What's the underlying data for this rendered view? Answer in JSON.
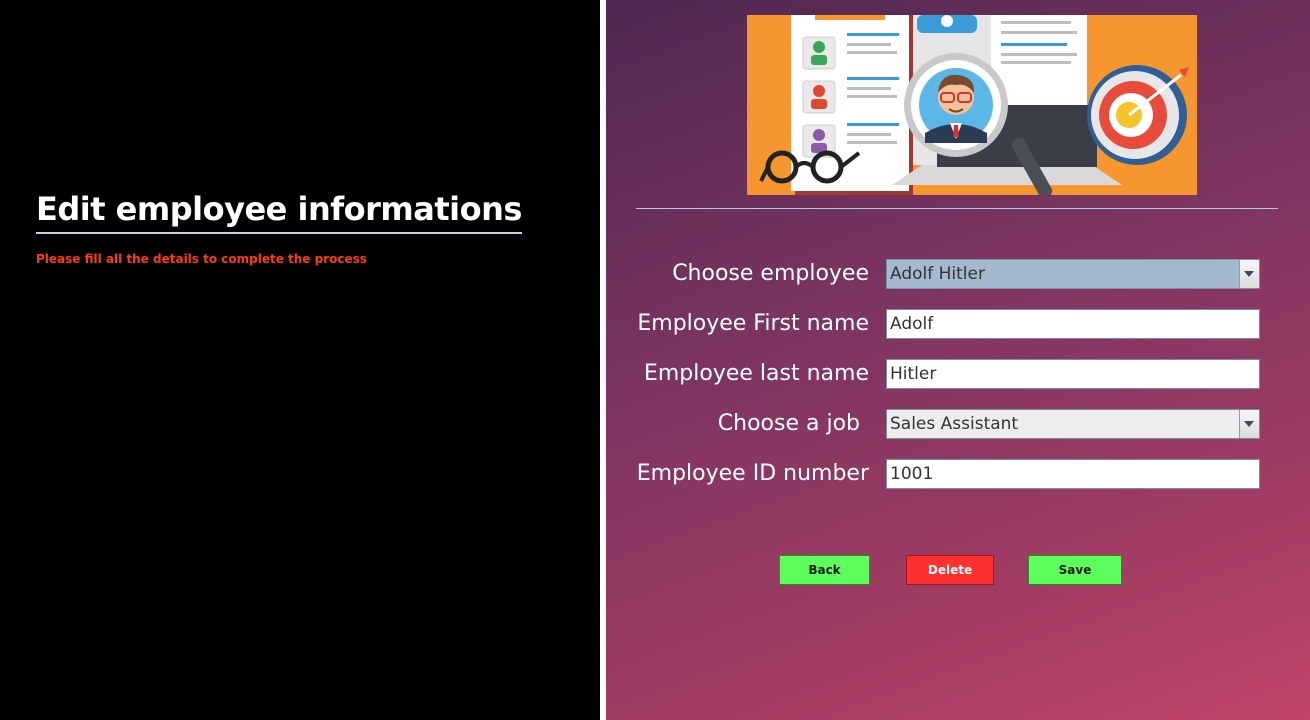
{
  "left": {
    "title": "Edit employee informations",
    "subtitle": "Please fill all the details to complete the process"
  },
  "form": {
    "choose_employee_label": "Choose employee",
    "choose_employee_value": "Adolf Hitler",
    "first_name_label": "Employee First name",
    "first_name_value": "Adolf",
    "last_name_label": "Employee last name",
    "last_name_value": "Hitler",
    "job_label": "Choose a job",
    "job_value": "Sales Assistant",
    "id_label": "Employee ID number",
    "id_value": "1001"
  },
  "buttons": {
    "back": "Back",
    "delete": "Delete",
    "save": "Save"
  },
  "colors": {
    "left_bg": "#000000",
    "subtitle": "#ff3b14",
    "save_back": "#5cff5c",
    "delete": "#ff3030"
  },
  "icons": {
    "illustration": "hr-recruitment-illustration",
    "dropdown": "chevron-down-icon"
  }
}
